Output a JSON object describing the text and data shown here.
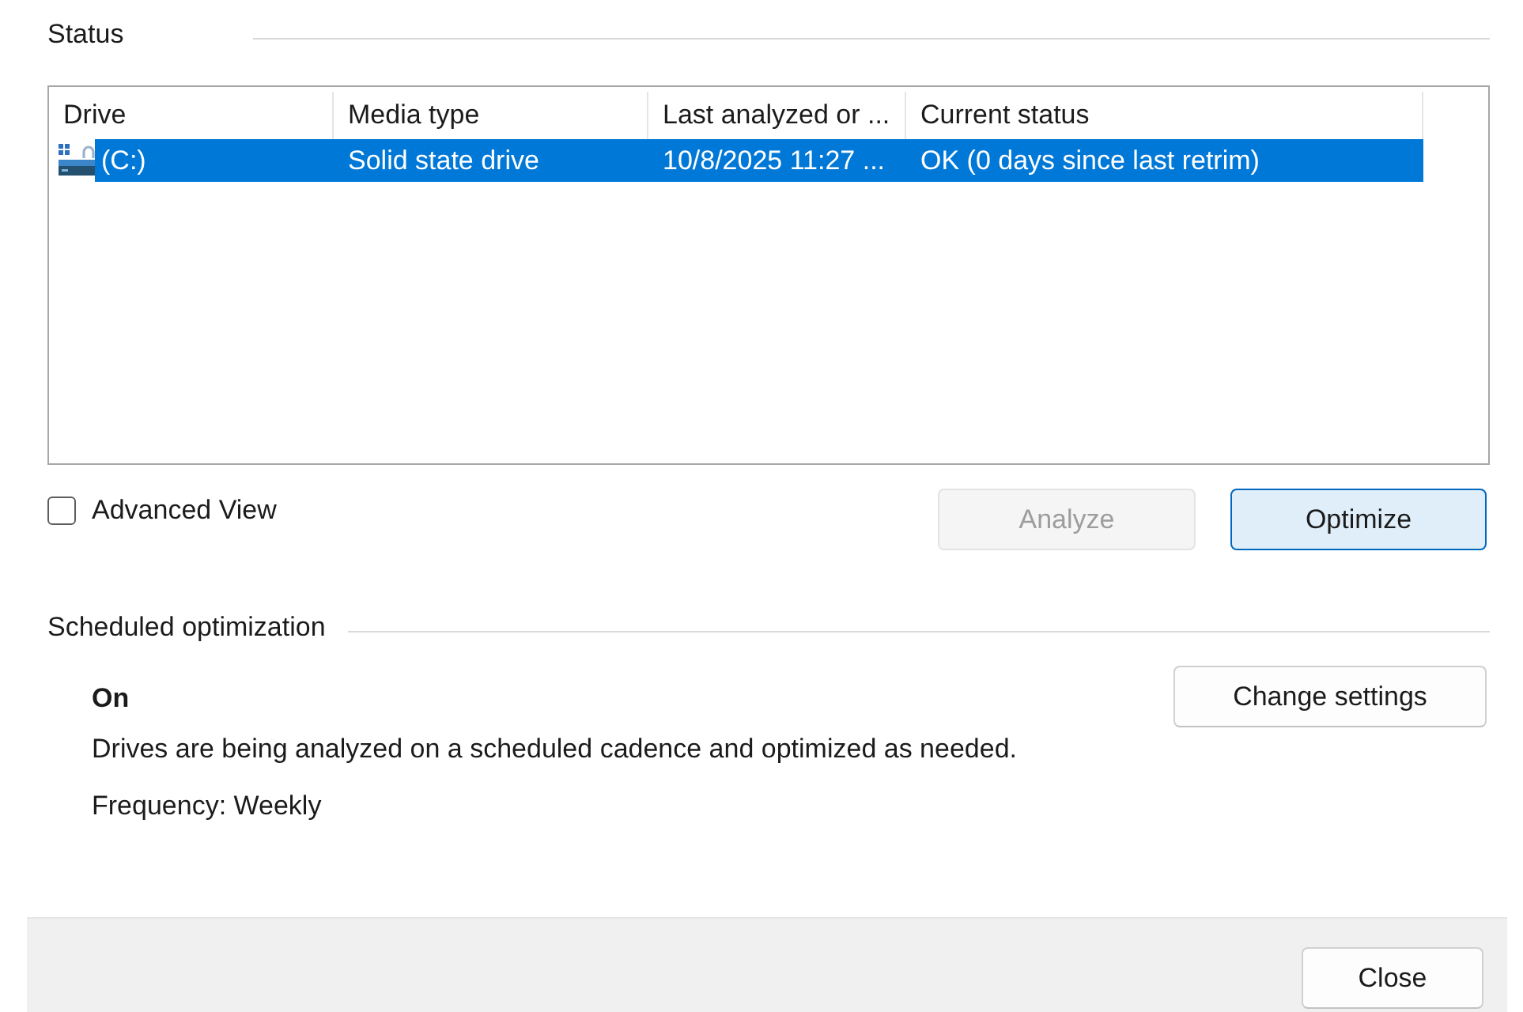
{
  "status_section": {
    "title": "Status"
  },
  "drive_table": {
    "columns": [
      "Drive",
      "Media type",
      "Last analyzed or ...",
      "Current status"
    ],
    "rows": [
      {
        "selected": true,
        "cells": [
          "(C:)",
          "Solid state drive",
          "10/8/2025 11:27 ...",
          "OK (0 days since last retrim)"
        ]
      }
    ]
  },
  "advanced_view": {
    "label": "Advanced View",
    "checked": false
  },
  "actions": [
    {
      "label": "Analyze",
      "disabled": true,
      "default": false
    },
    {
      "label": "Optimize",
      "disabled": false,
      "default": true
    }
  ],
  "scheduled_section": {
    "title": "Scheduled optimization",
    "state": "On",
    "description": "Drives are being analyzed on a scheduled cadence and optimized as needed.",
    "frequency": "Frequency: Weekly",
    "button": "Change settings"
  },
  "footer": {
    "buttons": [
      "Close"
    ]
  }
}
